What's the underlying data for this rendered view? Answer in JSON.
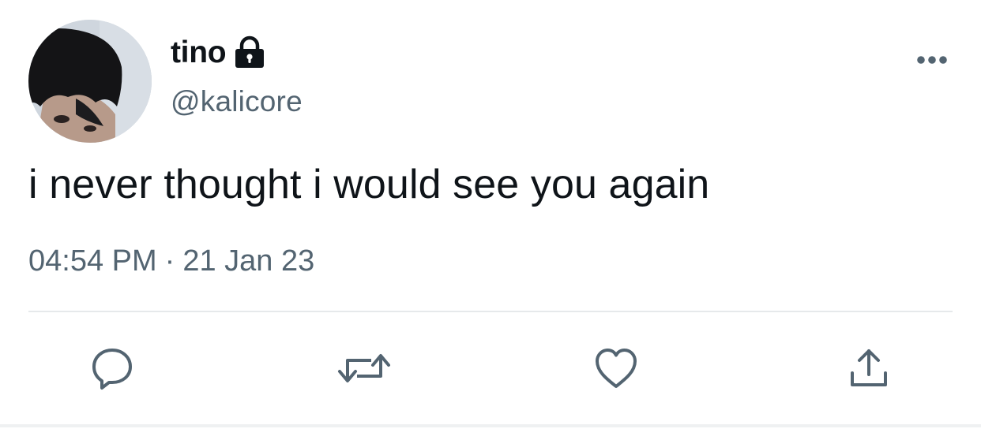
{
  "author": {
    "display_name": "tino",
    "handle": "@kalicore",
    "protected_icon": "lock-icon",
    "avatar": "profile-photo"
  },
  "tweet": {
    "text": "i never thought i would see you again",
    "time": "04:54 PM",
    "separator": "·",
    "date": "21 Jan 23"
  },
  "actions": [
    {
      "name": "reply",
      "icon": "speech-bubble-icon"
    },
    {
      "name": "retweet",
      "icon": "retweet-arrows-icon"
    },
    {
      "name": "like",
      "icon": "heart-icon"
    },
    {
      "name": "share",
      "icon": "share-upload-icon"
    }
  ],
  "more_menu_icon": "ellipsis-icon",
  "colors": {
    "text_primary": "#0f1419",
    "text_secondary": "#536471",
    "icon": "#536471",
    "divider": "#e6e9eb",
    "background": "#ffffff"
  }
}
